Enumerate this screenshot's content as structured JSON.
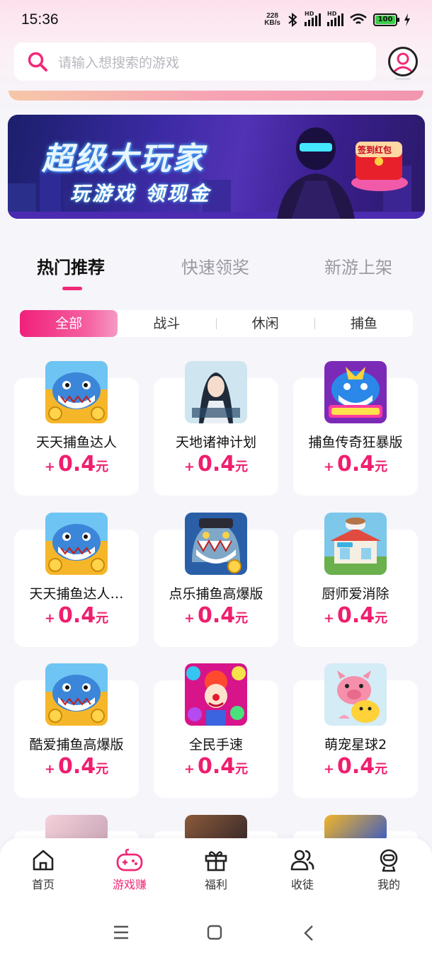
{
  "status_bar": {
    "time": "15:36",
    "net_speed_value": "228",
    "net_speed_unit": "KB/s",
    "hd1": "HD",
    "hd2": "HD",
    "battery": "100"
  },
  "search": {
    "placeholder": "请输入想搜索的游戏"
  },
  "banner": {
    "title": "超级大玩家",
    "subtitle": "玩游戏 领现金",
    "badge": "签到红包"
  },
  "tabs": [
    {
      "label": "热门推荐",
      "active": true
    },
    {
      "label": "快速领奖",
      "active": false
    },
    {
      "label": "新游上架",
      "active": false
    }
  ],
  "categories": [
    {
      "label": "全部",
      "active": true
    },
    {
      "label": "战斗",
      "active": false
    },
    {
      "label": "休闲",
      "active": false
    },
    {
      "label": "捕鱼",
      "active": false
    }
  ],
  "reward_plus": "+",
  "reward_unit": "元",
  "games": [
    {
      "name": "天天捕鱼达人",
      "reward": "0.4",
      "icon": "shark-fish-icon"
    },
    {
      "name": "天地诸神计划",
      "reward": "0.4",
      "icon": "goddess-icon"
    },
    {
      "name": "捕鱼传奇狂暴版",
      "reward": "0.4",
      "icon": "gold-shark-icon"
    },
    {
      "name": "天天捕鱼达人…",
      "reward": "0.4",
      "icon": "shark-fish-icon"
    },
    {
      "name": "点乐捕鱼高爆版",
      "reward": "0.4",
      "icon": "shark-coins-icon"
    },
    {
      "name": "厨师爱消除",
      "reward": "0.4",
      "icon": "cafe-icon"
    },
    {
      "name": "酷爱捕鱼高爆版",
      "reward": "0.4",
      "icon": "shark-fish-icon"
    },
    {
      "name": "全民手速",
      "reward": "0.4",
      "icon": "clown-icon"
    },
    {
      "name": "萌宠星球2",
      "reward": "0.4",
      "icon": "pig-icon"
    }
  ],
  "nav": [
    {
      "label": "首页",
      "icon": "home-icon",
      "active": false
    },
    {
      "label": "游戏赚",
      "icon": "gamepad-icon",
      "active": true
    },
    {
      "label": "福利",
      "icon": "gift-icon",
      "active": false
    },
    {
      "label": "收徒",
      "icon": "users-icon",
      "active": false
    },
    {
      "label": "我的",
      "icon": "robot-icon",
      "active": false
    }
  ],
  "colors": {
    "accent": "#ef2a77",
    "reward": "#ef1e6e",
    "background": "#f5f5fa"
  }
}
